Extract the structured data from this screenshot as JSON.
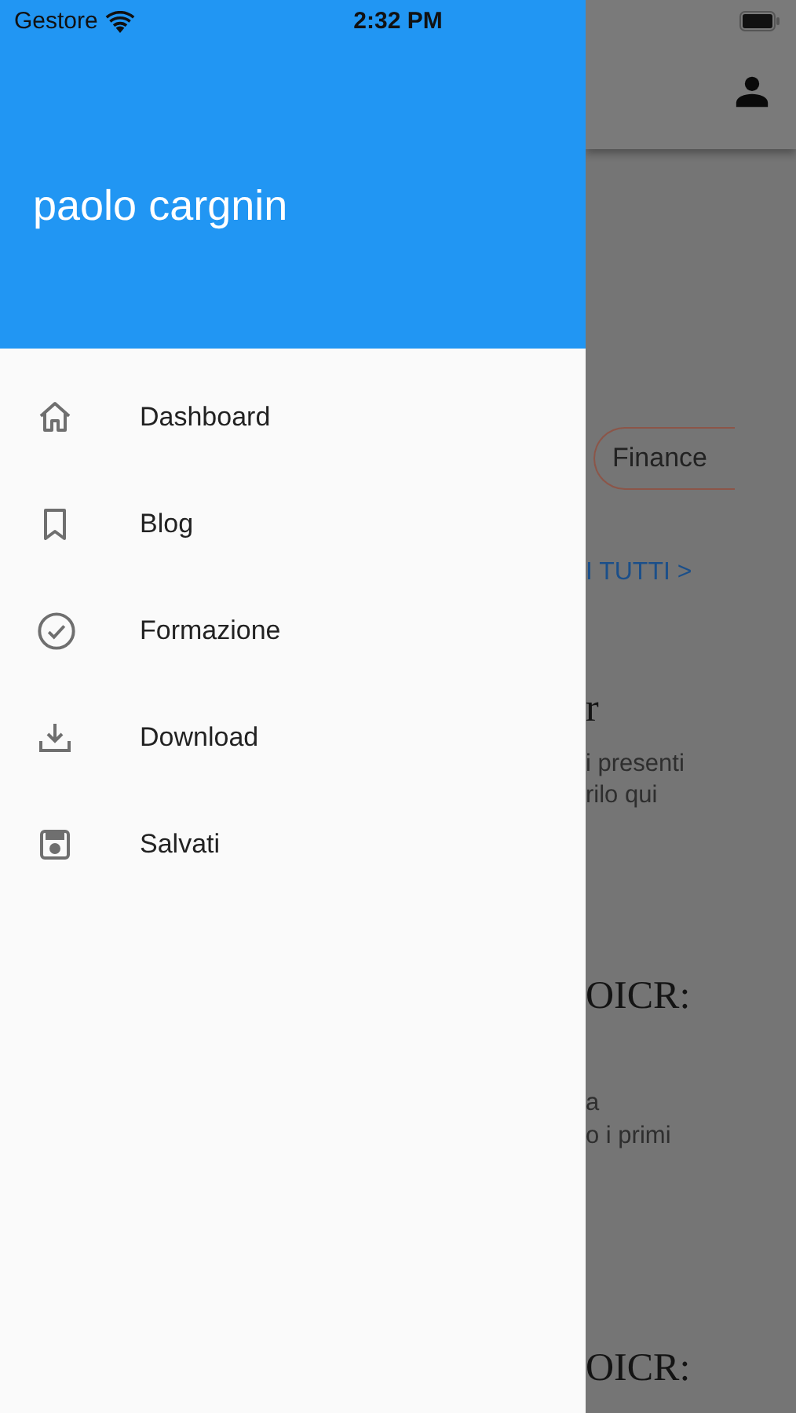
{
  "status_bar": {
    "carrier": "Gestore",
    "time": "2:32 PM"
  },
  "drawer": {
    "user_name": "paolo cargnin",
    "items": [
      {
        "label": "Dashboard"
      },
      {
        "label": "Blog"
      },
      {
        "label": "Formazione"
      },
      {
        "label": "Download"
      },
      {
        "label": "Salvati"
      }
    ]
  },
  "background": {
    "items": [
      {
        "kind": "chip",
        "text": "Finance"
      },
      {
        "kind": "link",
        "text": "I TUTTI >"
      },
      {
        "kind": "heading",
        "text": "r"
      },
      {
        "kind": "body",
        "text": "i presenti"
      },
      {
        "kind": "body",
        "text": "rilo qui"
      },
      {
        "kind": "heading",
        "text": "OICR:"
      },
      {
        "kind": "body",
        "text": "a"
      },
      {
        "kind": "body",
        "text": "o i primi"
      },
      {
        "kind": "heading",
        "text": "OICR:"
      }
    ]
  }
}
